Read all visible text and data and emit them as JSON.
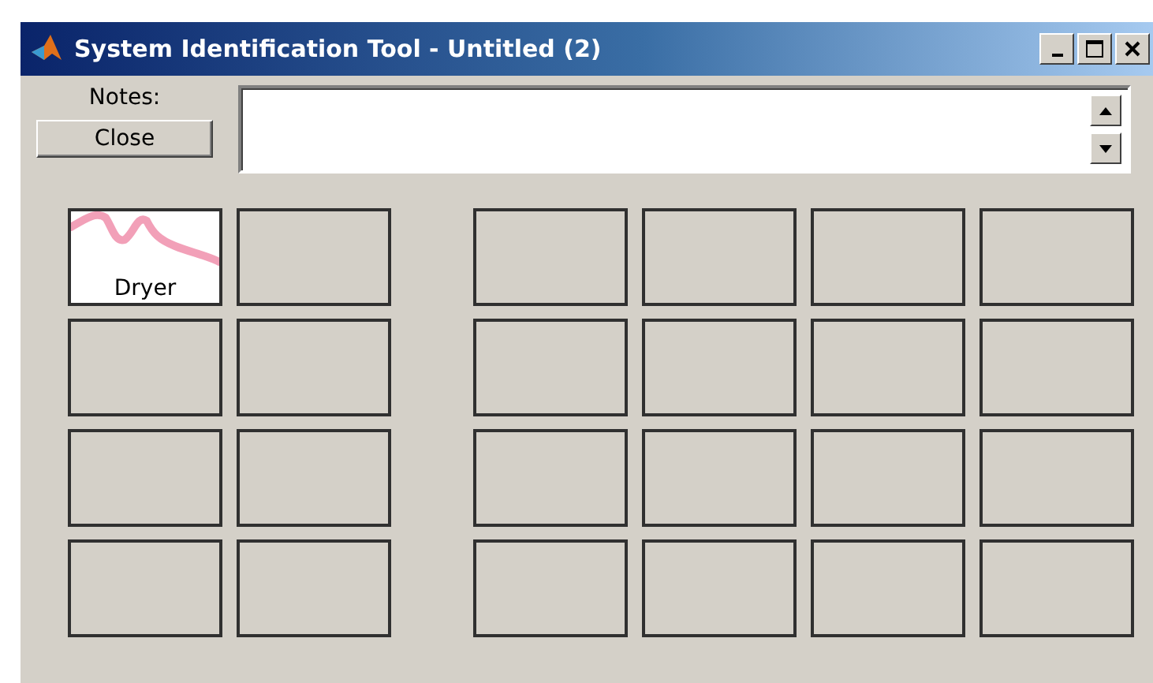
{
  "window": {
    "title": "System Identification Tool - Untitled (2)"
  },
  "notes": {
    "label": "Notes:"
  },
  "buttons": [
    {
      "label": "Close"
    }
  ],
  "data_board": [
    {
      "kind": "data",
      "name": "Dryer",
      "color": "#f2a0b8"
    },
    {
      "kind": "empty"
    },
    {
      "kind": "empty"
    },
    {
      "kind": "empty"
    },
    {
      "kind": "empty"
    },
    {
      "kind": "empty"
    },
    {
      "kind": "empty"
    },
    {
      "kind": "empty"
    }
  ],
  "model_board": [
    {
      "kind": "empty"
    },
    {
      "kind": "empty"
    },
    {
      "kind": "empty"
    },
    {
      "kind": "empty"
    },
    {
      "kind": "empty"
    },
    {
      "kind": "empty"
    },
    {
      "kind": "empty"
    },
    {
      "kind": "empty"
    },
    {
      "kind": "empty"
    },
    {
      "kind": "empty"
    },
    {
      "kind": "empty"
    },
    {
      "kind": "empty"
    },
    {
      "kind": "empty"
    },
    {
      "kind": "empty"
    },
    {
      "kind": "empty"
    },
    {
      "kind": "empty"
    }
  ]
}
